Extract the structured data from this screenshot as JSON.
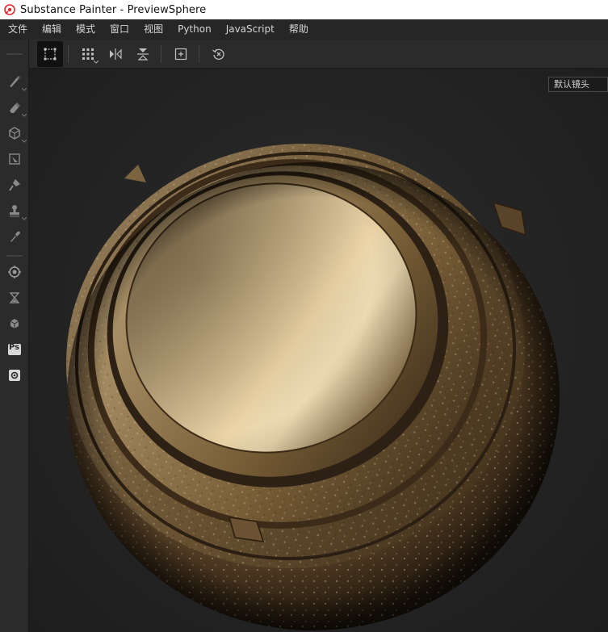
{
  "window": {
    "title": "Substance Painter - PreviewSphere"
  },
  "menu": {
    "items": [
      "文件",
      "编辑",
      "模式",
      "窗口",
      "视图",
      "Python",
      "JavaScript",
      "帮助"
    ]
  },
  "toolbar": {
    "icons": [
      "selection-icon",
      "grid-icon",
      "mirror-x-icon",
      "mirror-y-icon",
      "frame-icon",
      "reset-icon"
    ]
  },
  "toolbox": {
    "icons": [
      "brush-icon",
      "eraser-icon",
      "projection-icon",
      "polygon-fill-icon",
      "smudge-icon",
      "clone-icon",
      "color-picker-icon",
      "bake-icon",
      "export-icon",
      "iray-icon",
      "photoshop-icon",
      "screenshot-icon"
    ],
    "ps_label": "Ps"
  },
  "viewport": {
    "camera": "默认镜头"
  },
  "colors": {
    "accent": "#e5272b",
    "panel": "#2b2b2b",
    "menubar": "#262626",
    "viewport": "#232323"
  }
}
